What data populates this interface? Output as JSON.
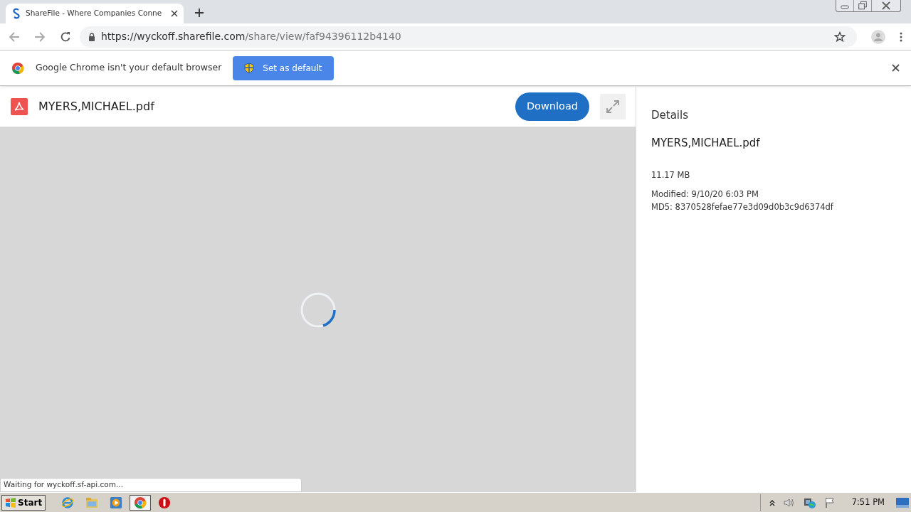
{
  "browser": {
    "tab": {
      "title": "ShareFile - Where Companies Conne",
      "selected": true
    },
    "address": {
      "host": "https://wyckoff.sharefile.com",
      "path": "/share/view/faf94396112b4140"
    }
  },
  "infobar": {
    "message": "Google Chrome isn't your default browser",
    "button": "Set as default"
  },
  "viewer": {
    "file_name": "MYERS,MICHAEL.pdf",
    "download": "Download",
    "loading": true
  },
  "details": {
    "heading": "Details",
    "file_name": "MYERS,MICHAEL.pdf",
    "size": "11.17 MB",
    "modified": "Modified: 9/10/20 6:03 PM",
    "md5": "MD5: 8370528fefae77e3d09d0b3c9d6374df"
  },
  "status_text": "Waiting for wyckoff.sf-api.com...",
  "taskbar": {
    "start": "Start",
    "apps": [
      {
        "kind": "ie",
        "selected": false
      },
      {
        "kind": "folder",
        "selected": false
      },
      {
        "kind": "media",
        "selected": false
      },
      {
        "kind": "chrome",
        "selected": true
      },
      {
        "kind": "opera",
        "selected": false
      }
    ],
    "clock": "7:51 PM"
  }
}
